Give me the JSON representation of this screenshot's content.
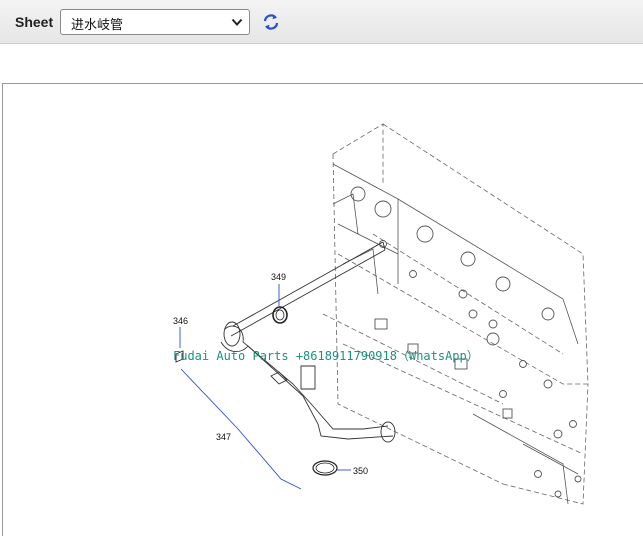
{
  "toolbar": {
    "sheet_label": "Sheet",
    "sheet_selected": "进水岐管",
    "icons": {
      "dropdown": "chevron-down-icon",
      "refresh": "refresh-icon"
    },
    "accent_color": "#2b4fcf"
  },
  "drawing": {
    "watermark": "Fudai Auto Parts +8618911790918（WhatsApp）",
    "watermark_color": "#1f8f82",
    "callouts": {
      "c346": "346",
      "c347": "347",
      "c349": "349",
      "c350": "350"
    }
  }
}
